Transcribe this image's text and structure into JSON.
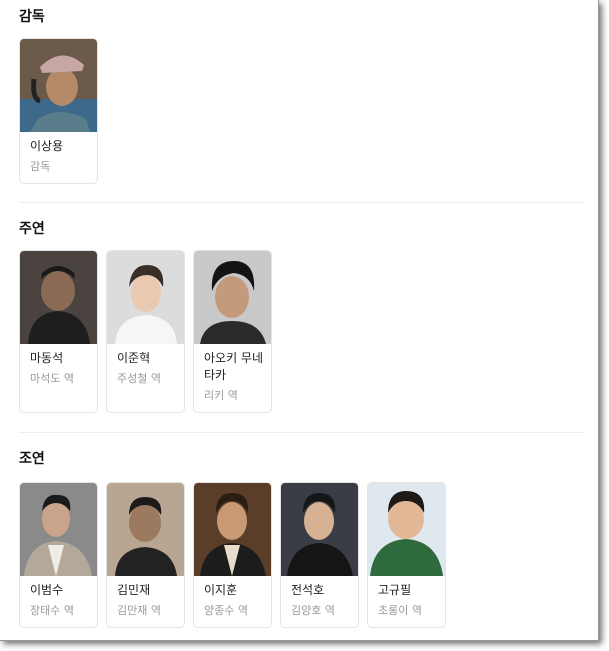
{
  "sections": {
    "director": {
      "title": "감독",
      "people": [
        {
          "name": "이상용",
          "role": "감독"
        }
      ]
    },
    "lead": {
      "title": "주연",
      "people": [
        {
          "name": "마동석",
          "role": "마석도 역"
        },
        {
          "name": "이준혁",
          "role": "주성철 역"
        },
        {
          "name": "아오키 무네타카",
          "role": "리키 역"
        }
      ]
    },
    "supporting": {
      "title": "조연",
      "people": [
        {
          "name": "이범수",
          "role": "장태수 역"
        },
        {
          "name": "김민재",
          "role": "김만재 역"
        },
        {
          "name": "이지훈",
          "role": "양종수 역"
        },
        {
          "name": "전석호",
          "role": "김양호 역"
        },
        {
          "name": "고규필",
          "role": "초롱이 역"
        }
      ]
    }
  },
  "colors": {
    "card_border": "#e4e4e4",
    "role_text": "#999999",
    "divider": "#eeeeee"
  }
}
